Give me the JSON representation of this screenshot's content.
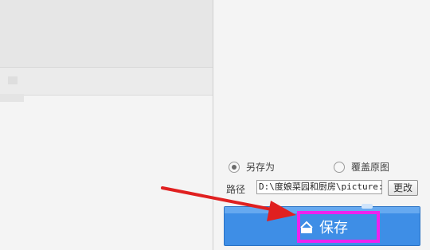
{
  "options": {
    "save_as_label": "另存为",
    "save_as_checked": true,
    "overwrite_label": "覆盖原图",
    "overwrite_checked": false
  },
  "path": {
    "label": "路径",
    "value": "D:\\度娘菜园和厨房\\picture:",
    "change_label": "更改"
  },
  "save_button": {
    "label": "保存",
    "icon": "save-icon"
  },
  "colors": {
    "save_button": "#3e8ee6",
    "highlight_frame": "#ee22ee",
    "arrow": "#e02020"
  }
}
